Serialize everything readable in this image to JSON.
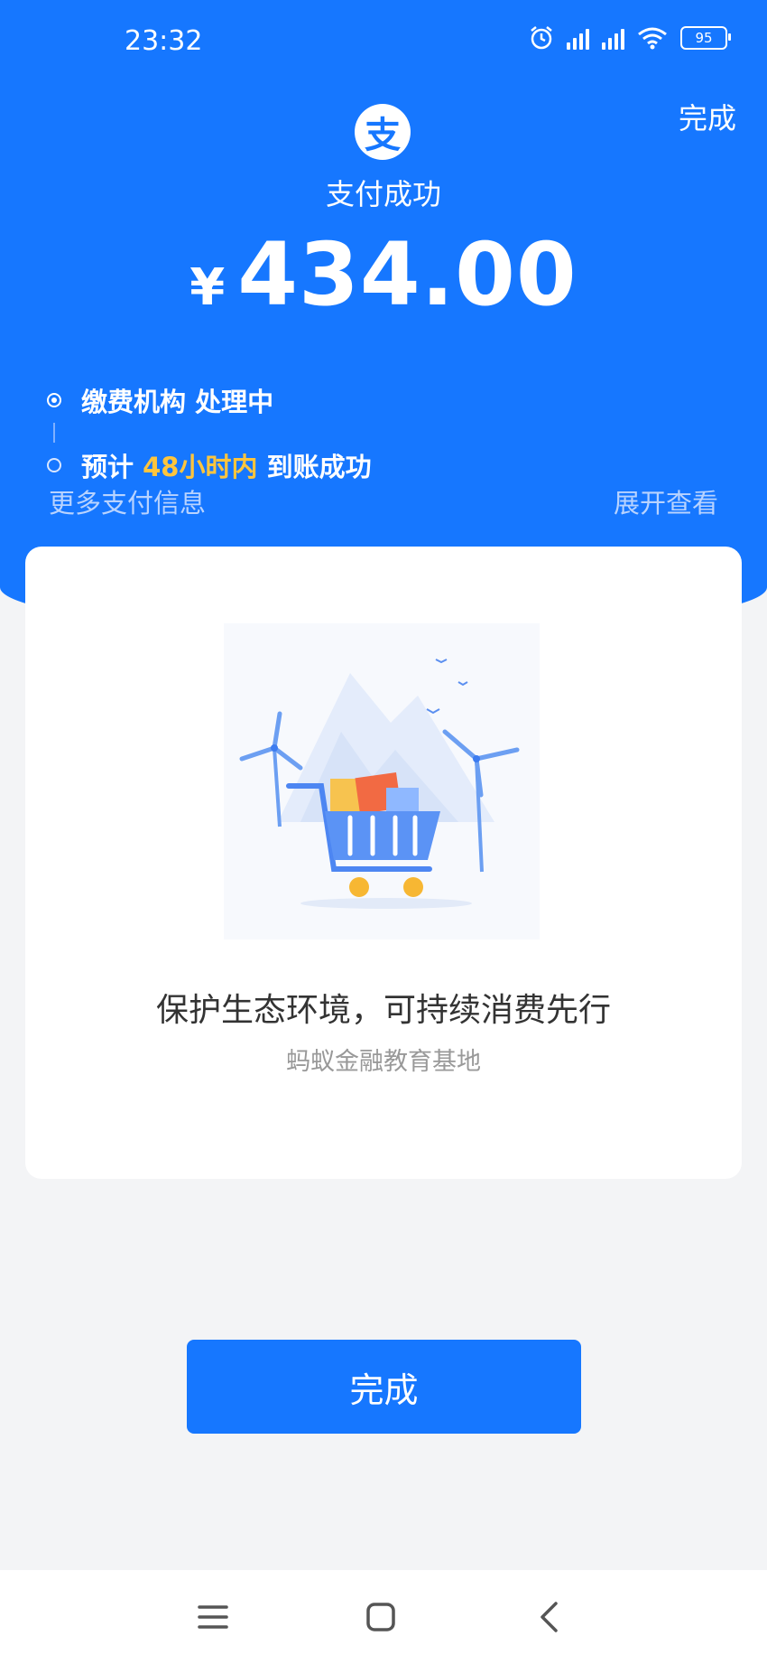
{
  "status_bar": {
    "time": "23:32",
    "battery": "95"
  },
  "header": {
    "done_label": "完成",
    "logo_char": "支",
    "pay_status": "支付成功",
    "currency_symbol": "¥",
    "amount": "434.00"
  },
  "timeline": {
    "step1_org": "缴费机构",
    "step1_status": "处理中",
    "step2_prefix": "预计",
    "step2_highlight": "48小时内",
    "step2_suffix": "到账成功"
  },
  "more_info": {
    "label": "更多支付信息",
    "expand_label": "展开查看"
  },
  "card": {
    "title": "保护生态环境，可持续消费先行",
    "subtitle": "蚂蚁金融教育基地"
  },
  "done_button": {
    "label": "完成"
  },
  "colors": {
    "brand": "#1677ff",
    "highlight": "#ffc53d",
    "background": "#f3f4f6"
  }
}
